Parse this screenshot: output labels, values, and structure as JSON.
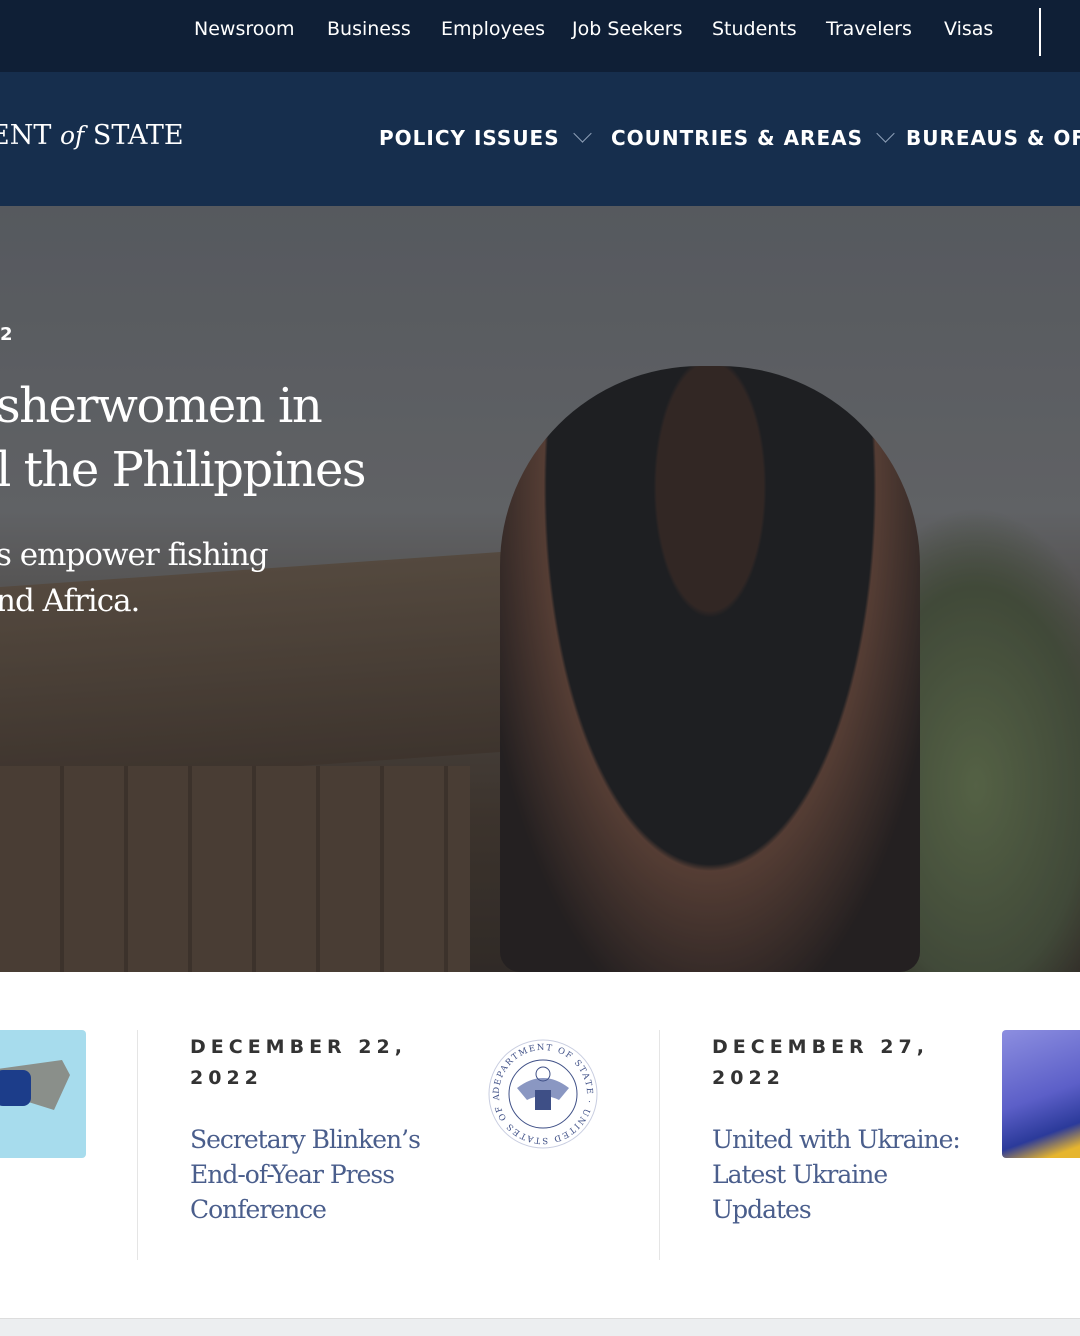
{
  "utility_nav": [
    "Newsroom",
    "Business",
    "Employees",
    "Job Seekers",
    "Students",
    "Travelers",
    "Visas"
  ],
  "logo": {
    "pre": "ENT ",
    "of": "of",
    "post": " STATE"
  },
  "main_nav": [
    {
      "label": "POLICY ISSUES",
      "has_dropdown": true
    },
    {
      "label": "COUNTRIES & AREAS",
      "has_dropdown": true
    },
    {
      "label": "BUREAUS & OFFI",
      "has_dropdown": false
    }
  ],
  "hero": {
    "date": "2",
    "title_lines": [
      "sherwomen in",
      "l the Philippines"
    ],
    "subtitle_lines": [
      "s empower fishing",
      "nd Africa."
    ]
  },
  "cards": [
    {
      "date": "DECEMBER 22, 2022",
      "title": "Secretary Blinken’s End-of-Year Press Conference",
      "image": "department-of-state-seal"
    },
    {
      "date": "DECEMBER 27, 2022",
      "title": "United with Ukraine: Latest Ukraine Updates",
      "image": "ukraine-illustration"
    }
  ],
  "seal_text": "DEPARTMENT OF STATE · UNITED STATES OF AMERICA",
  "colors": {
    "utility_bg": "#0f1f36",
    "nav_bg": "#162e4d",
    "link": "#4a5e8c"
  }
}
